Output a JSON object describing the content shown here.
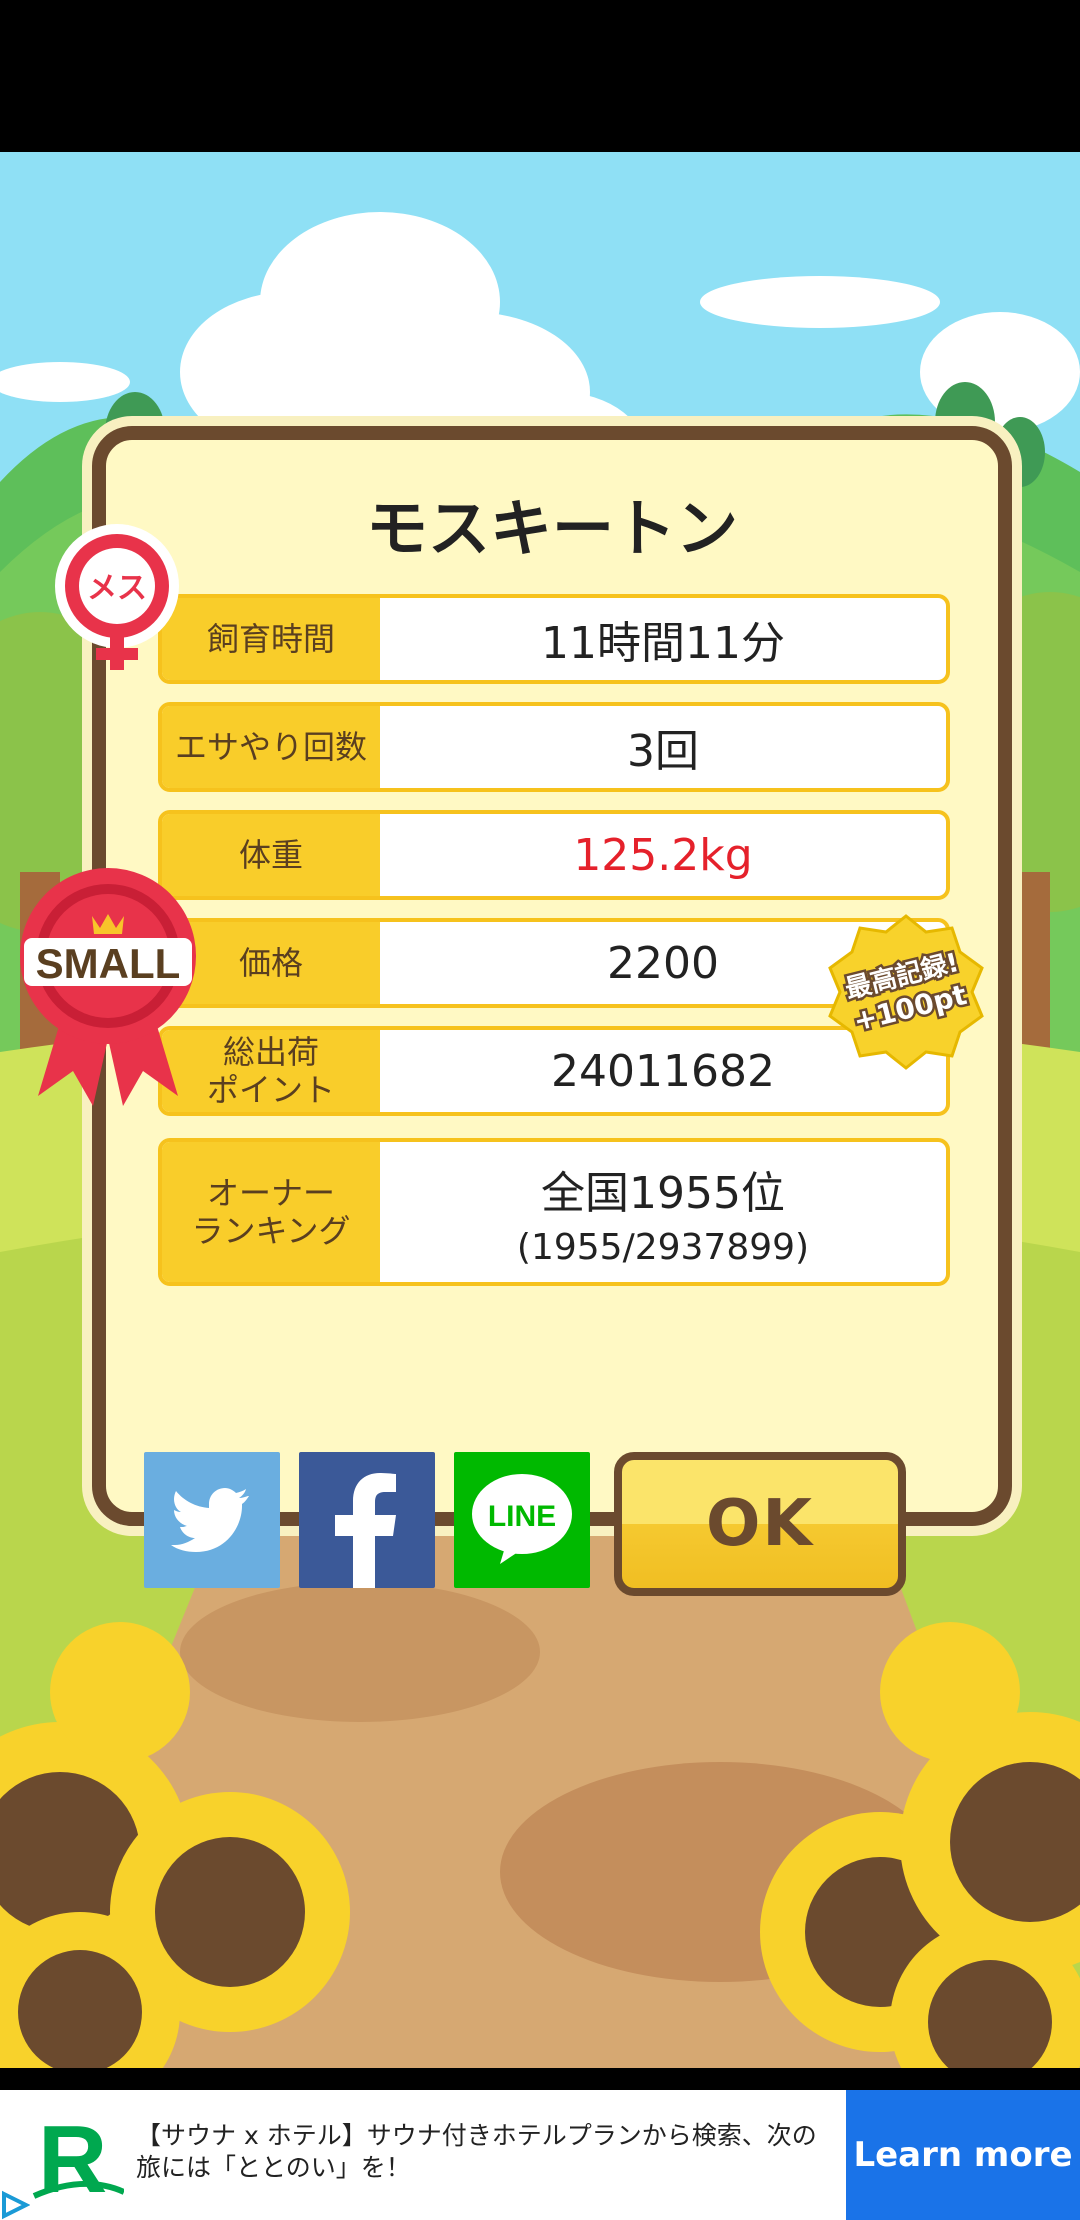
{
  "dialog": {
    "title": "モスキートン",
    "rows": [
      {
        "label": "飼育時間",
        "value": "11時間11分"
      },
      {
        "label": "エサやり回数",
        "value": "3回"
      },
      {
        "label": "体重",
        "value": "125.2kg"
      },
      {
        "label": "価格",
        "value": "2200"
      },
      {
        "label": "総出荷\nポイント",
        "value": "24011682"
      },
      {
        "label": "オーナー\nランキング",
        "value": "全国1955位",
        "sub": "(1955/2937899)"
      }
    ]
  },
  "badges": {
    "gender": "メス",
    "size": "SMALL",
    "record_line1": "最高記録!",
    "record_line2": "+100pt"
  },
  "share": {
    "twitter": "twitter-icon",
    "facebook": "facebook-icon",
    "line": "LINE"
  },
  "ok_label": "OK",
  "ad": {
    "logo": "R",
    "text": "【サウナ x ホテル】サウナ付きホテルプランから検索、次の旅には「ととのい」を！",
    "cta": "Learn more"
  },
  "colors": {
    "sky": "#8fe0f5",
    "dialog_bg": "#fff9c4",
    "dialog_border": "#6b4a2e",
    "label_bg": "#f9cd2a",
    "weight_red": "#e5212b",
    "twitter": "#6aaee0",
    "facebook": "#3b5998",
    "line": "#00b900",
    "ad_cta": "#1a73e8"
  }
}
